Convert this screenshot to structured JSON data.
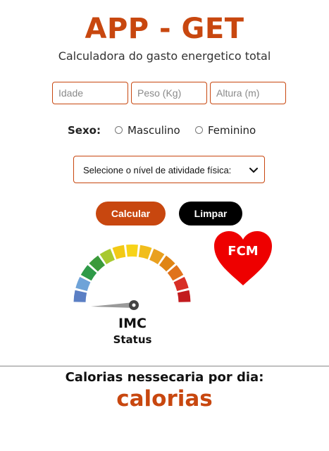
{
  "header": {
    "title": "APP - GET",
    "subtitle": "Calculadora do gasto energetico total"
  },
  "form": {
    "idade": {
      "placeholder": "Idade",
      "value": ""
    },
    "peso": {
      "placeholder": "Peso (Kg)",
      "value": ""
    },
    "altura": {
      "placeholder": "Altura (m)",
      "value": ""
    },
    "sexo": {
      "label": "Sexo:",
      "options": [
        "Masculino",
        "Feminino"
      ],
      "selected": null
    },
    "atividade": {
      "selected_label": "Selecione o nível de atividade física:"
    },
    "buttons": {
      "calcular": "Calcular",
      "limpar": "Limpar"
    }
  },
  "result": {
    "fcm_label": "FCM",
    "imc_label": "IMC",
    "status_label": "Status",
    "calorias_heading": "Calorias nessecaria por dia:",
    "calorias_value": "calorias"
  },
  "icons": {
    "heart": "heart-icon",
    "gauge": "imc-gauge",
    "select_arrow": "chevron-down-icon"
  },
  "colors": {
    "accent": "#c8470f",
    "button_dark": "#000000",
    "heart": "#ee0000",
    "gauge_segments": [
      "#5b7fc4",
      "#6fa3d8",
      "#2e9a48",
      "#3a9a3a",
      "#a8c92f",
      "#f2c915",
      "#f7d318",
      "#f1bd1c",
      "#e9a01f",
      "#e08515",
      "#e0731b",
      "#d82f26",
      "#c21b1e"
    ],
    "gauge_needle": "#9a9a9a",
    "gauge_hub": "#444444"
  }
}
